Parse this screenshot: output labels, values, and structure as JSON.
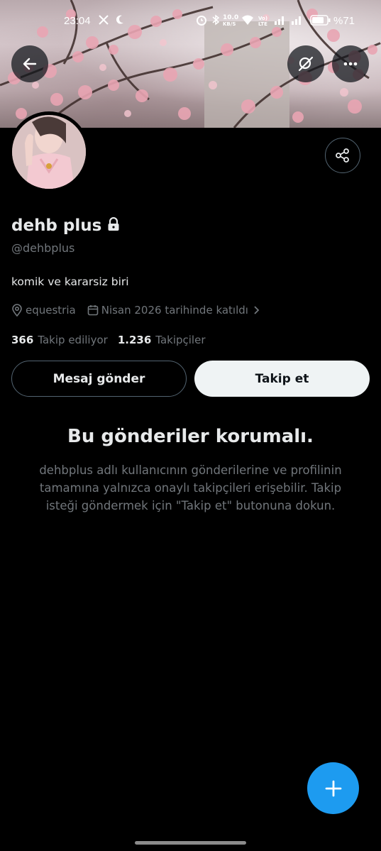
{
  "status_bar": {
    "time": "23:04",
    "net_speed_value": "10.0",
    "net_speed_unit": "KB/S",
    "volte_line1": "Vo)",
    "volte_line2": "LTE",
    "battery_text": "%71",
    "icons": [
      "x-logo-icon",
      "moon-icon",
      "alarm-icon",
      "bluetooth-icon",
      "wifi-icon",
      "signal-icon",
      "battery-icon"
    ]
  },
  "header": {
    "back_icon": "arrow-left-icon",
    "search_icon": "search-off-icon",
    "more_icon": "more-horizontal-icon"
  },
  "profile": {
    "display_name": "dehb plus",
    "handle": "@dehbplus",
    "bio": "komik ve kararsiz biri",
    "location": "equestria",
    "joined": "Nisan 2026 tarihinde katıldı",
    "following_count": "366",
    "following_label": "Takip ediliyor",
    "followers_count": "1.236",
    "followers_label": "Takipçiler",
    "locked_icon": "lock-icon"
  },
  "actions": {
    "message_label": "Mesaj gönder",
    "follow_label": "Takip et",
    "share_icon": "share-icon"
  },
  "protected_notice": {
    "title": "Bu gönderiler korumalı.",
    "description": "dehbplus adlı kullanıcının gönderilerine ve profilinin tamamına yalnızca onaylı takipçileri erişebilir. Takip isteği göndermek için \"Takip et\" butonuna dokun."
  },
  "fab": {
    "icon": "plus-icon"
  },
  "colors": {
    "background": "#000000",
    "primary_text": "#e7e9ea",
    "secondary_text": "#71767b",
    "accent": "#1d9bf0",
    "follow_button_bg": "#eff3f4",
    "border": "#536471"
  }
}
